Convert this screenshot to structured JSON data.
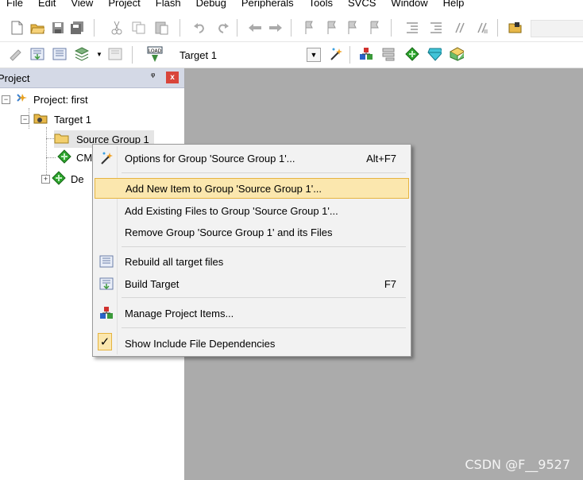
{
  "menubar": {
    "items": [
      "File",
      "Edit",
      "View",
      "Project",
      "Flash",
      "Debug",
      "Peripherals",
      "Tools",
      "SVCS",
      "Window",
      "Help"
    ]
  },
  "toolbar2": {
    "target_value": "Target 1",
    "load_label": "LOAD"
  },
  "project_panel": {
    "title": "Project",
    "pin": "ᵠ",
    "close": "x",
    "tree": {
      "root": "Project: first",
      "target": "Target 1",
      "group": "Source Group 1",
      "child_cmsis": "CM",
      "child_device": "De"
    }
  },
  "context_menu": {
    "items": [
      {
        "label": "Options for Group 'Source Group 1'...",
        "shortcut": "Alt+F7"
      },
      {
        "label": "Add New  Item to Group 'Source Group 1'...",
        "shortcut": ""
      },
      {
        "label": "Add Existing Files to Group 'Source Group 1'...",
        "shortcut": ""
      },
      {
        "label": "Remove Group 'Source Group 1' and its Files",
        "shortcut": ""
      },
      {
        "label": "Rebuild all target files",
        "shortcut": ""
      },
      {
        "label": "Build Target",
        "shortcut": "F7"
      },
      {
        "label": "Manage Project Items...",
        "shortcut": ""
      },
      {
        "label": "Show Include File Dependencies",
        "shortcut": "",
        "checked": true
      }
    ]
  },
  "watermark": "CSDN @F__9527",
  "colors": {
    "highlight": "#fbe7ae",
    "highlight_border": "#e6b440",
    "editor_bg": "#ababab",
    "panel_header": "#d4d9e6",
    "close_button": "#d9453a"
  }
}
